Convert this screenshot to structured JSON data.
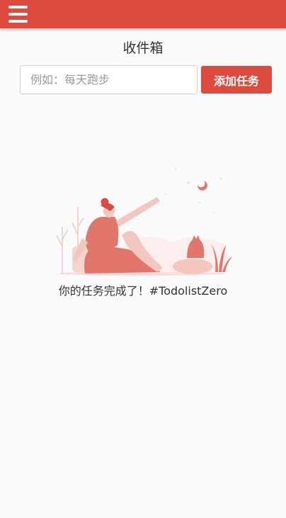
{
  "header": {
    "menu_icon": "hamburger-menu-icon",
    "accent_color": "#dd4b3e"
  },
  "page": {
    "title": "收件箱"
  },
  "add_task": {
    "placeholder": "例如：每天跑步",
    "value": "",
    "button_label": "添加任务"
  },
  "empty_state": {
    "illustration": "woman-relaxing-under-moon-illustration",
    "message": "你的任务完成了！#TodolistZero"
  }
}
